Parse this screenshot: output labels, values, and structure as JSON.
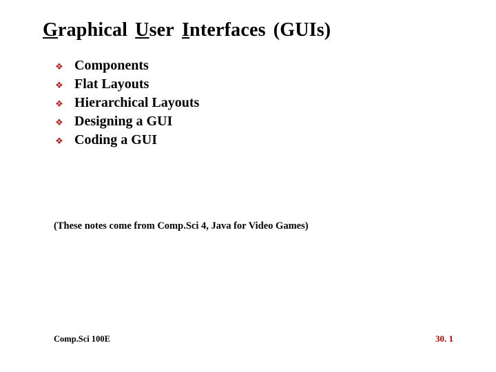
{
  "title": {
    "w1": "Graphical",
    "w2": "User",
    "w3": "Interfaces",
    "w4": "(GUIs)"
  },
  "bullets": {
    "b1": "Components",
    "b2": "Flat Layouts",
    "b3": "Hierarchical Layouts",
    "b4": "Designing a GUI",
    "b5": "Coding a GUI"
  },
  "subnote": "(These notes come from Comp.Sci 4, Java for Video Games)",
  "footer": {
    "left": "Comp.Sci 100E",
    "right": "30. 1"
  }
}
